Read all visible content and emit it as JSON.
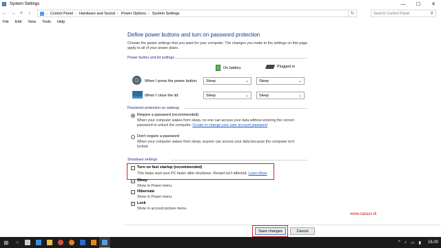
{
  "window": {
    "title": "System Settings",
    "controls": [
      "—",
      "☐",
      "✕"
    ]
  },
  "address": {
    "nav": [
      "←",
      "→",
      "˅",
      "↑"
    ],
    "crumbs": [
      "Control Panel",
      "Hardware and Sound",
      "Power Options",
      "System Settings"
    ],
    "separator": "›",
    "refresh": "↻",
    "search_placeholder": "Search Control Panel"
  },
  "menu": [
    "File",
    "Edit",
    "View",
    "Tools",
    "Help"
  ],
  "page": {
    "heading": "Define power buttons and turn on password protection",
    "description": "Choose the power settings that you want for your computer. The changes you make to the settings on this page apply to all of your power plans."
  },
  "buttons_section": {
    "title": "Power button and lid settings",
    "col_battery": "On battery",
    "col_plugged": "Plugged in",
    "rows": [
      {
        "label": "When I press the power button:",
        "battery": "Sleep",
        "plugged": "Sleep"
      },
      {
        "label": "When I close the lid:",
        "battery": "Sleep",
        "plugged": "Sleep"
      }
    ]
  },
  "password_section": {
    "title": "Password protection on wakeup",
    "options": [
      {
        "label": "Require a password (recommended)",
        "desc1": "When your computer wakes from sleep, no one can access your data without entering the correct",
        "desc2": "password to unlock the computer.",
        "link": "Create or change your user account password",
        "selected": true
      },
      {
        "label": "Don't require a password",
        "desc1": "When your computer wakes from sleep, anyone can access your data because the computer isn't",
        "desc2": "locked.",
        "selected": false
      }
    ]
  },
  "shutdown_section": {
    "title": "Shutdown settings",
    "items": [
      {
        "label": "Turn on fast startup (recommended)",
        "desc": "This helps start your PC faster after shutdown. Restart isn't affected.",
        "link": "Learn More",
        "checked": false
      },
      {
        "label": "Sleep",
        "desc": "Show in Power menu.",
        "checked": true
      },
      {
        "label": "Hibernate",
        "desc": "Show in Power menu.",
        "checked": false
      },
      {
        "label": "Lock",
        "desc": "Show in account picture menu.",
        "checked": true
      }
    ]
  },
  "watermark": "www.nataus.tk",
  "actions": {
    "save": "Save changes",
    "cancel": "Cancel"
  },
  "taskbar": {
    "start": "⊞",
    "search": "○",
    "apps": [
      {
        "name": "task-view",
        "color": "#cccccc"
      },
      {
        "name": "edge",
        "color": "#3c8be0"
      },
      {
        "name": "file-explorer",
        "color": "#e8c04a"
      },
      {
        "name": "chrome",
        "color": "#e04a3c"
      },
      {
        "name": "firefox",
        "color": "#e87d2a"
      },
      {
        "name": "photoshop",
        "color": "#2a6ac4"
      },
      {
        "name": "illustrator",
        "color": "#e08a1a"
      },
      {
        "name": "control-panel",
        "color": "#5a9be0"
      }
    ],
    "tray": [
      "^",
      "♪",
      "▭",
      "▮"
    ],
    "clock": "16.00"
  },
  "colors": {
    "accent": "#1e3287",
    "highlight": "#d42020",
    "link": "#1a58c4"
  }
}
